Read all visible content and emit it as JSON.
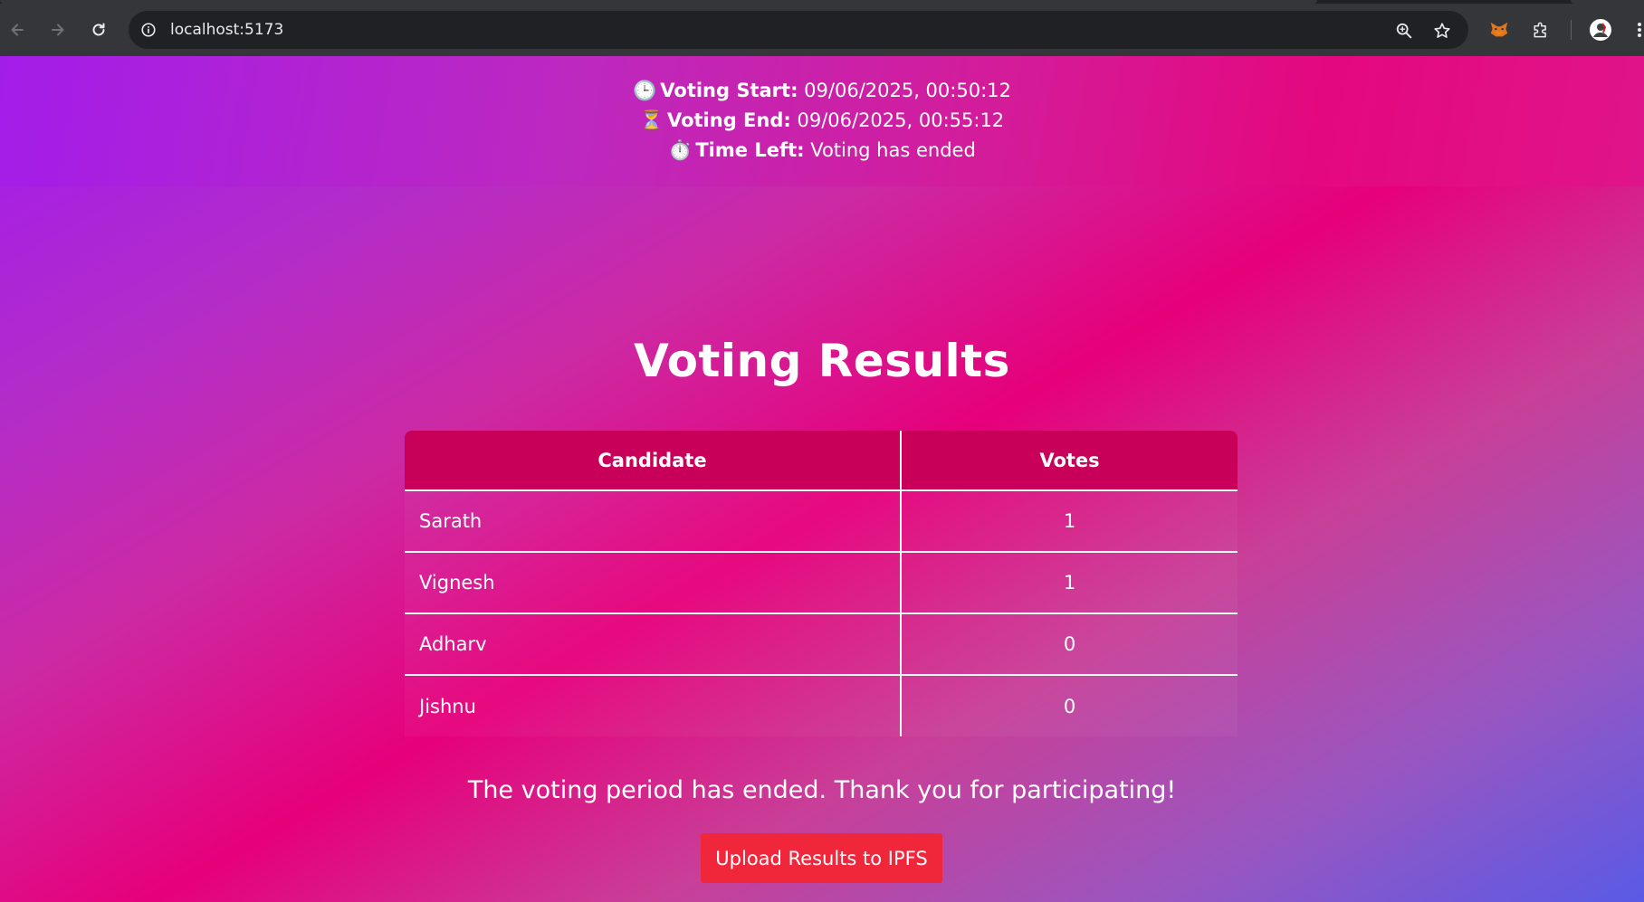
{
  "browser": {
    "url": "localhost:5173",
    "icons": {
      "back": "arrow-left-icon",
      "forward": "arrow-right-icon",
      "reload": "reload-icon",
      "site_info": "info-icon",
      "zoom": "zoom-icon",
      "bookmark": "star-icon",
      "extension_fox": "metamask-fox-icon",
      "extensions": "puzzle-icon",
      "profile": "avatar",
      "menu": "kebab-menu-icon"
    }
  },
  "header": {
    "start_label": "Voting Start:",
    "start_value": "09/06/2025, 00:50:12",
    "end_label": "Voting End:",
    "end_value": "09/06/2025, 00:55:12",
    "left_label": "Time Left:",
    "left_value": "Voting has ended",
    "start_emoji": "🕒",
    "end_emoji": "⏳",
    "left_emoji": "⏱️"
  },
  "main": {
    "title": "Voting Results",
    "table": {
      "headers": [
        "Candidate",
        "Votes"
      ],
      "rows": [
        {
          "candidate": "Sarath",
          "votes": "1"
        },
        {
          "candidate": "Vignesh",
          "votes": "1"
        },
        {
          "candidate": "Adharv",
          "votes": "0"
        },
        {
          "candidate": "Jishnu",
          "votes": "0"
        }
      ]
    },
    "ended_message": "The voting period has ended. Thank you for participating!",
    "upload_button": "Upload Results to IPFS"
  },
  "colors": {
    "header_cell": "#c8005a",
    "button": "#f0263b",
    "gradient_start": "#a11aef",
    "gradient_mid": "#e6007a",
    "gradient_end": "#5a5ae6"
  }
}
